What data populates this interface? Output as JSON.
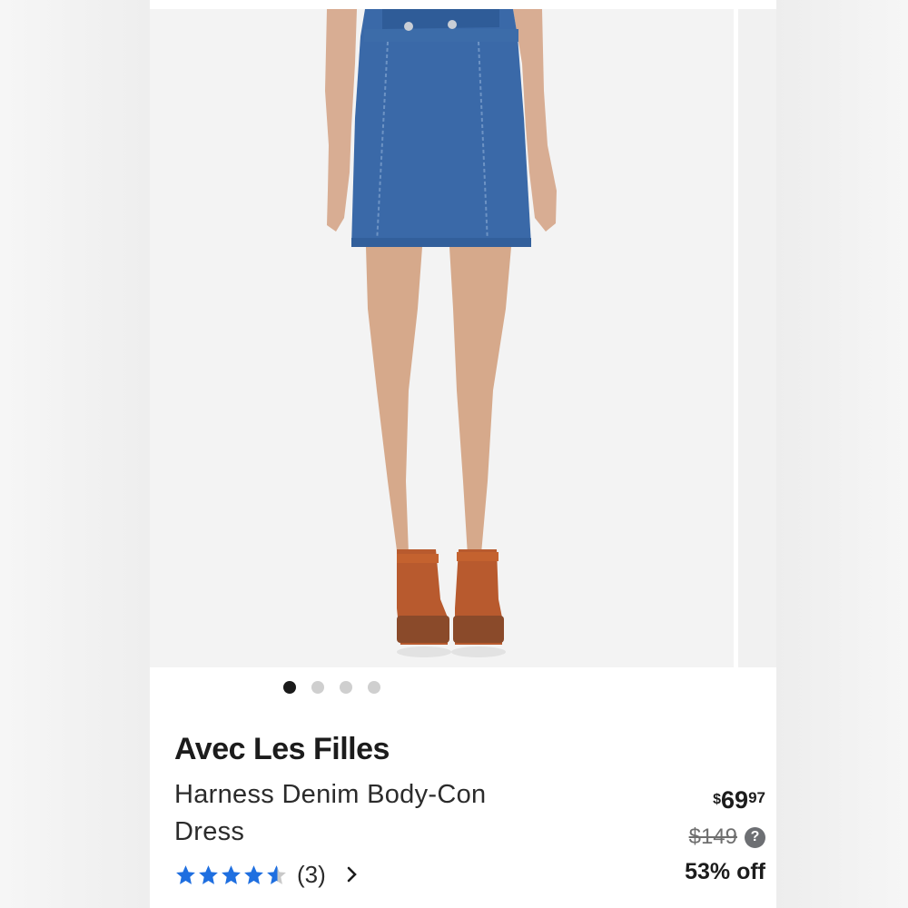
{
  "gallery": {
    "image_description": "model-wearing-denim-skirt-with-red-platform-sandals",
    "dots": [
      {
        "active": true
      },
      {
        "active": false
      },
      {
        "active": false
      },
      {
        "active": false
      }
    ]
  },
  "product": {
    "brand": "Avec Les Filles",
    "name": "Harness Denim Body-Con Dress",
    "rating": {
      "stars": 4.5,
      "count_label": "(3)",
      "star_color": "#1f6fe0"
    },
    "price": {
      "currency": "$",
      "dollars": "69",
      "cents": "97",
      "original": "$149",
      "help_symbol": "?",
      "discount": "53% off"
    }
  }
}
